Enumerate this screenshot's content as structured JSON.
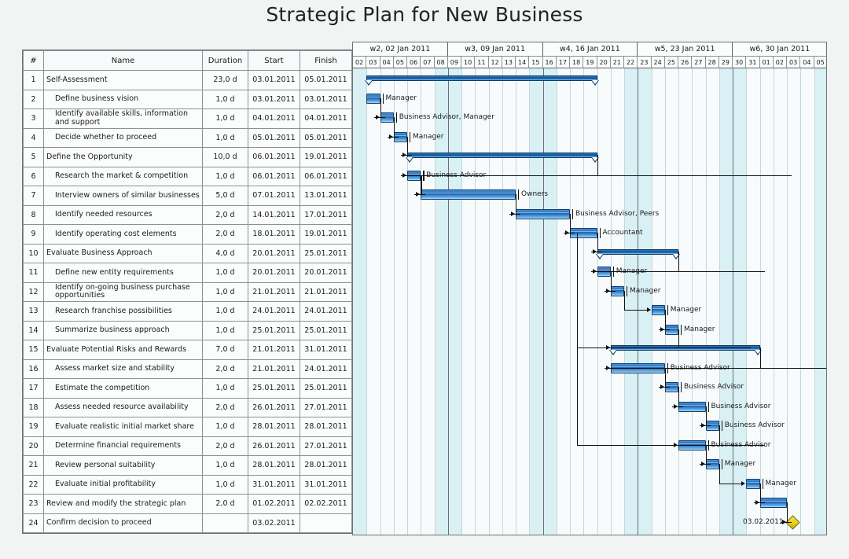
{
  "title": "Strategic Plan for New Business",
  "table": {
    "headers": {
      "num": "#",
      "name": "Name",
      "duration": "Duration",
      "start": "Start",
      "finish": "Finish"
    },
    "rows": [
      {
        "num": "1",
        "name": "Self-Assessment",
        "level": 0,
        "duration": "23,0 d",
        "start": "03.01.2011",
        "finish": "05.01.2011"
      },
      {
        "num": "2",
        "name": "Define business vision",
        "level": 1,
        "duration": "1,0 d",
        "start": "03.01.2011",
        "finish": "03.01.2011"
      },
      {
        "num": "3",
        "name": "Identify available skills, information and support",
        "level": 1,
        "duration": "1,0 d",
        "start": "04.01.2011",
        "finish": "04.01.2011"
      },
      {
        "num": "4",
        "name": "Decide whether to proceed",
        "level": 1,
        "duration": "1,0 d",
        "start": "05.01.2011",
        "finish": "05.01.2011"
      },
      {
        "num": "5",
        "name": "Define the Opportunity",
        "level": 0,
        "duration": "10,0 d",
        "start": "06.01.2011",
        "finish": "19.01.2011"
      },
      {
        "num": "6",
        "name": "Research the market & competition",
        "level": 1,
        "duration": "1,0 d",
        "start": "06.01.2011",
        "finish": "06.01.2011"
      },
      {
        "num": "7",
        "name": "Interview owners of similar businesses",
        "level": 1,
        "duration": "5,0 d",
        "start": "07.01.2011",
        "finish": "13.01.2011"
      },
      {
        "num": "8",
        "name": "Identify needed resources",
        "level": 1,
        "duration": "2,0 d",
        "start": "14.01.2011",
        "finish": "17.01.2011"
      },
      {
        "num": "9",
        "name": "Identify operating cost elements",
        "level": 1,
        "duration": "2,0 d",
        "start": "18.01.2011",
        "finish": "19.01.2011"
      },
      {
        "num": "10",
        "name": "Evaluate Business Approach",
        "level": 0,
        "duration": "4,0 d",
        "start": "20.01.2011",
        "finish": "25.01.2011"
      },
      {
        "num": "11",
        "name": "Define new entity requirements",
        "level": 1,
        "duration": "1,0 d",
        "start": "20.01.2011",
        "finish": "20.01.2011"
      },
      {
        "num": "12",
        "name": "Identify on-going business purchase opportunities",
        "level": 1,
        "duration": "1,0 d",
        "start": "21.01.2011",
        "finish": "21.01.2011"
      },
      {
        "num": "13",
        "name": "Research franchise possibilities",
        "level": 1,
        "duration": "1,0 d",
        "start": "24.01.2011",
        "finish": "24.01.2011"
      },
      {
        "num": "14",
        "name": "Summarize business approach",
        "level": 1,
        "duration": "1,0 d",
        "start": "25.01.2011",
        "finish": "25.01.2011"
      },
      {
        "num": "15",
        "name": "Evaluate Potential Risks and Rewards",
        "level": 0,
        "duration": "7,0 d",
        "start": "21.01.2011",
        "finish": "31.01.2011"
      },
      {
        "num": "16",
        "name": "Assess market size and stability",
        "level": 1,
        "duration": "2,0 d",
        "start": "21.01.2011",
        "finish": "24.01.2011"
      },
      {
        "num": "17",
        "name": "Estimate the competition",
        "level": 1,
        "duration": "1,0 d",
        "start": "25.01.2011",
        "finish": "25.01.2011"
      },
      {
        "num": "18",
        "name": "Assess needed resource availability",
        "level": 1,
        "duration": "2,0 d",
        "start": "26.01.2011",
        "finish": "27.01.2011"
      },
      {
        "num": "19",
        "name": "Evaluate realistic initial market share",
        "level": 1,
        "duration": "1,0 d",
        "start": "28.01.2011",
        "finish": "28.01.2011"
      },
      {
        "num": "20",
        "name": "Determine financial requirements",
        "level": 1,
        "duration": "2,0 d",
        "start": "26.01.2011",
        "finish": "27.01.2011"
      },
      {
        "num": "21",
        "name": "Review personal suitability",
        "level": 1,
        "duration": "1,0 d",
        "start": "28.01.2011",
        "finish": "28.01.2011"
      },
      {
        "num": "22",
        "name": "Evaluate initial profitability",
        "level": 1,
        "duration": "1,0 d",
        "start": "31.01.2011",
        "finish": "31.01.2011"
      },
      {
        "num": "23",
        "name": "Review and modify the strategic plan",
        "level": 0,
        "duration": "2,0 d",
        "start": "01.02.2011",
        "finish": "02.02.2011"
      },
      {
        "num": "24",
        "name": "Confirm decision to proceed",
        "level": 0,
        "duration": "",
        "start": "03.02.2011",
        "finish": ""
      }
    ]
  },
  "chart_data": {
    "type": "bar",
    "title": "Strategic Plan for New Business",
    "weeks": [
      {
        "label": "w2, 02 Jan 2011",
        "days": 7
      },
      {
        "label": "w3, 09 Jan 2011",
        "days": 7
      },
      {
        "label": "w4, 16 Jan 2011",
        "days": 7
      },
      {
        "label": "w5, 23 Jan 2011",
        "days": 7
      },
      {
        "label": "w6, 30 Jan 2011",
        "days": 7
      }
    ],
    "days": [
      "02",
      "03",
      "04",
      "05",
      "06",
      "07",
      "08",
      "09",
      "10",
      "11",
      "12",
      "13",
      "14",
      "15",
      "16",
      "17",
      "18",
      "19",
      "20",
      "21",
      "22",
      "23",
      "24",
      "25",
      "26",
      "27",
      "28",
      "29",
      "30",
      "31",
      "01",
      "02",
      "03",
      "04",
      "05"
    ],
    "weekend_indices": [
      0,
      6,
      7,
      13,
      14,
      20,
      21,
      27,
      28,
      34
    ],
    "day_width": 17.25,
    "colors": {
      "bar_fill": "#2f7cc8",
      "bar_border": "#10406f",
      "summary_fill": "#11518f",
      "milestone_fill": "#e8d223",
      "weekend_shade": "#d9f0f5",
      "chart_bg": "#f7fbfc"
    },
    "bars": [
      {
        "row": 1,
        "type": "summary",
        "start_idx": 1,
        "len": 17,
        "resource": ""
      },
      {
        "row": 2,
        "type": "task",
        "start_idx": 1,
        "len": 1,
        "resource": "Manager"
      },
      {
        "row": 3,
        "type": "task",
        "start_idx": 2,
        "len": 1,
        "resource": "Business Advisor, Manager"
      },
      {
        "row": 4,
        "type": "task",
        "start_idx": 3,
        "len": 1,
        "resource": "Manager"
      },
      {
        "row": 5,
        "type": "summary",
        "start_idx": 4,
        "len": 14,
        "resource": ""
      },
      {
        "row": 6,
        "type": "task",
        "start_idx": 4,
        "len": 1,
        "resource": "Business Advisor"
      },
      {
        "row": 7,
        "type": "task",
        "start_idx": 5,
        "len": 7,
        "resource": "Owners"
      },
      {
        "row": 8,
        "type": "task",
        "start_idx": 12,
        "len": 4,
        "resource": "Business Advisor, Peers"
      },
      {
        "row": 9,
        "type": "task",
        "start_idx": 16,
        "len": 2,
        "resource": "Accountant"
      },
      {
        "row": 10,
        "type": "summary",
        "start_idx": 18,
        "len": 6,
        "resource": ""
      },
      {
        "row": 11,
        "type": "task",
        "start_idx": 18,
        "len": 1,
        "resource": "Manager"
      },
      {
        "row": 12,
        "type": "task",
        "start_idx": 19,
        "len": 1,
        "resource": "Manager"
      },
      {
        "row": 13,
        "type": "task",
        "start_idx": 22,
        "len": 1,
        "resource": "Manager"
      },
      {
        "row": 14,
        "type": "task",
        "start_idx": 23,
        "len": 1,
        "resource": "Manager"
      },
      {
        "row": 15,
        "type": "summary",
        "start_idx": 19,
        "len": 11,
        "resource": ""
      },
      {
        "row": 16,
        "type": "task",
        "start_idx": 19,
        "len": 4,
        "resource": "Business Advisor"
      },
      {
        "row": 17,
        "type": "task",
        "start_idx": 23,
        "len": 1,
        "resource": "Business Advisor"
      },
      {
        "row": 18,
        "type": "task",
        "start_idx": 24,
        "len": 2,
        "resource": "Business Advisor"
      },
      {
        "row": 19,
        "type": "task",
        "start_idx": 26,
        "len": 1,
        "resource": "Business Advisor"
      },
      {
        "row": 20,
        "type": "task",
        "start_idx": 24,
        "len": 2,
        "resource": "Business Advisor"
      },
      {
        "row": 21,
        "type": "task",
        "start_idx": 26,
        "len": 1,
        "resource": "Manager"
      },
      {
        "row": 22,
        "type": "task",
        "start_idx": 29,
        "len": 1,
        "resource": "Manager"
      },
      {
        "row": 23,
        "type": "task",
        "start_idx": 30,
        "len": 2,
        "resource": ""
      },
      {
        "row": 24,
        "type": "milestone",
        "start_idx": 32,
        "len": 0,
        "resource": "",
        "label": "03.02.2011"
      }
    ]
  }
}
